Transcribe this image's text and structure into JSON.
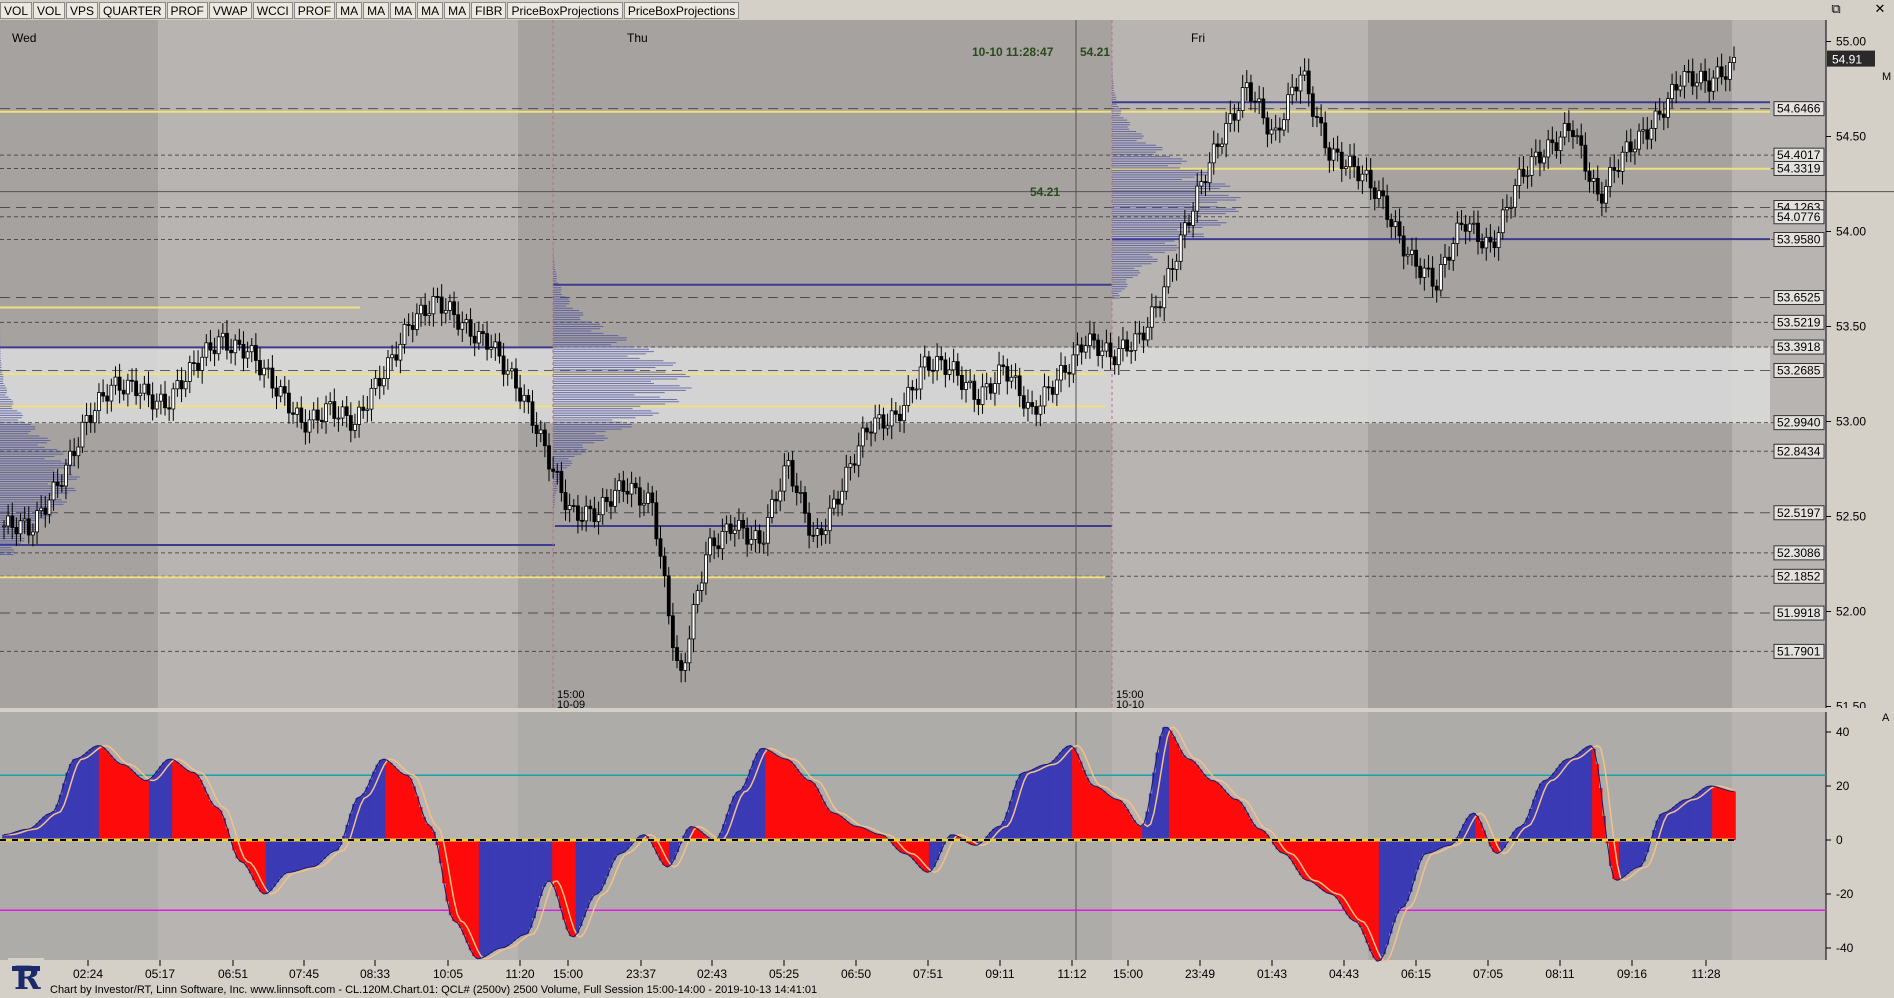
{
  "toolbar": {
    "buttons": [
      "VOL",
      "VOL",
      "VPS",
      "QUARTER",
      "PROF",
      "VWAP",
      "WCCI",
      "PROF",
      "MA",
      "MA",
      "MA",
      "MA",
      "MA",
      "FIBR",
      "PriceBoxProjections",
      "PriceBoxProjections"
    ]
  },
  "window_controls": {
    "restore": "⧉",
    "close": "✕"
  },
  "status_bar": "Chart by Investor/RT, Linn Software, Inc. www.linnsoft.com - CL.120M.Chart.01: QCL# (2500v) 2500 Volume, Full Session 15:00-14:00 - 2019-10-13 14:41:01",
  "colors": {
    "background": "#b7b4b1",
    "session_shade": "#a5a2a0",
    "value_area": "#dcdcdc",
    "profile": "#4a4fa0",
    "yellow_line": "#f0e080",
    "navy_line": "#3c3c8c",
    "indicator_blue": "#3a3ab4",
    "indicator_red": "#ff0a0a",
    "teal_line": "#16a3a3",
    "magenta_line": "#e01ce0"
  },
  "chart_data": [
    {
      "type": "candlestick",
      "x": [
        "02:24",
        "05:17",
        "06:51",
        "07:45",
        "08:33",
        "10:05",
        "11:20",
        "15:00",
        "23:37",
        "02:43",
        "05:25",
        "06:50",
        "07:51",
        "09:11",
        "11:12",
        "15:00",
        "23:49",
        "01:43",
        "04:43",
        "06:15",
        "07:05",
        "08:11",
        "09:16",
        "11:28"
      ],
      "y_ticks": [
        "55.00",
        "54.50",
        "54.00",
        "53.50",
        "53.00",
        "52.50",
        "52.00",
        "51.50"
      ],
      "ylim": [
        51.5,
        55.0
      ],
      "day_labels": [
        "Wed",
        "Thu",
        "Fri"
      ],
      "session_marks": [
        {
          "line1": "15:00",
          "line2": "10-09"
        },
        {
          "line1": "15:00",
          "line2": "10-10"
        }
      ],
      "crosshair": {
        "time": "10-10 11:28:47",
        "price_text": "54.21",
        "horizontal_label": "54.21"
      },
      "last_price": "54.91",
      "price_level_labels": [
        "54.6466",
        "54.4017",
        "54.3319",
        "54.1263",
        "54.0776",
        "53.9580",
        "53.6525",
        "53.5219",
        "53.3918",
        "53.2685",
        "52.9940",
        "52.8434",
        "52.5197",
        "52.3086",
        "52.1852",
        "51.9918",
        "51.7901"
      ],
      "price_levels": [
        54.6466,
        54.4017,
        54.3319,
        54.1263,
        54.0776,
        53.958,
        53.6525,
        53.5219,
        53.3918,
        53.2685,
        52.994,
        52.8434,
        52.5197,
        52.3086,
        52.1852,
        51.9918,
        51.7901
      ],
      "close_path": [
        52.45,
        52.4,
        52.7,
        53.0,
        53.15,
        53.2,
        53.1,
        53.25,
        53.45,
        53.4,
        53.15,
        53.0,
        53.1,
        52.95,
        53.25,
        53.55,
        53.6,
        53.5,
        53.45,
        53.15,
        52.85,
        52.55,
        52.5,
        52.65,
        52.6,
        51.6,
        52.3,
        52.5,
        52.35,
        52.75,
        52.4,
        52.65,
        52.95,
        53.05,
        53.3,
        53.25,
        53.15,
        53.3,
        53.0,
        53.25,
        53.45,
        53.3,
        53.45,
        53.75,
        54.1,
        54.5,
        54.8,
        54.45,
        54.85,
        54.45,
        54.3,
        54.15,
        53.9,
        53.7,
        54.05,
        53.95,
        54.25,
        54.4,
        54.6,
        54.15,
        54.4,
        54.6,
        54.8,
        54.75,
        54.91
      ]
    },
    {
      "type": "area",
      "name": "WCCI",
      "y_ticks": [
        "40",
        "20",
        "0",
        "-20",
        "-40"
      ],
      "ylim": [
        -40,
        40
      ],
      "values": [
        2,
        4,
        10,
        30,
        35,
        28,
        22,
        30,
        25,
        12,
        -8,
        -20,
        -12,
        -10,
        -4,
        16,
        30,
        24,
        5,
        -30,
        -44,
        -40,
        -35,
        -15,
        -36,
        -20,
        -5,
        2,
        -10,
        5,
        0,
        18,
        34,
        30,
        22,
        10,
        5,
        2,
        -5,
        -12,
        2,
        -2,
        5,
        25,
        28,
        35,
        20,
        15,
        5,
        42,
        30,
        22,
        15,
        4,
        -5,
        -15,
        -20,
        -30,
        -45,
        -25,
        -5,
        -2,
        10,
        -5,
        5,
        22,
        30,
        35,
        -15,
        -10,
        10,
        15,
        20,
        18
      ]
    }
  ],
  "x_time_labels": [
    "02:24",
    "05:17",
    "06:51",
    "07:45",
    "08:33",
    "10:05",
    "11:20",
    "15:00",
    "23:37",
    "02:43",
    "05:25",
    "06:50",
    "07:51",
    "09:11",
    "11:12",
    "15:00",
    "23:49",
    "01:43",
    "04:43",
    "06:15",
    "07:05",
    "08:11",
    "09:16",
    "11:28"
  ],
  "corner_marks": {
    "price_pane": "M",
    "indicator_pane": "A"
  }
}
